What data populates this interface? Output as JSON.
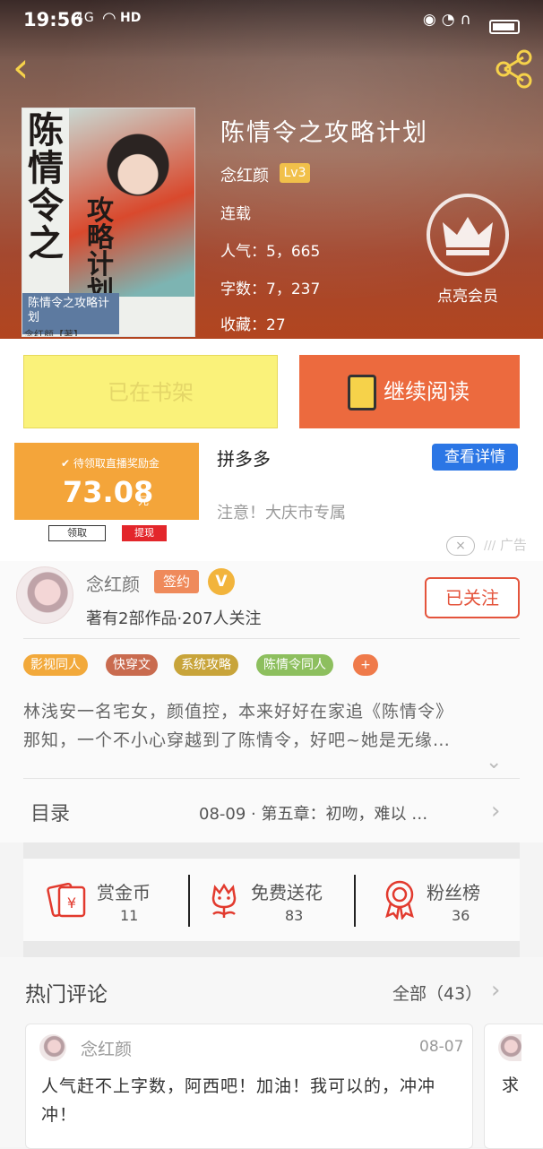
{
  "status_bar": {
    "time": "19:56",
    "network": "4G",
    "hd": "HD"
  },
  "book": {
    "title": "陈情令之攻略计划",
    "author": "念红颜",
    "level": "Lv3",
    "status": "连载",
    "popularity": "人气：5，665",
    "words": "字数：7，237",
    "favorites": "收藏：27",
    "cover": {
      "title_main": "陈情令之",
      "title_sub": "攻略计划",
      "box_text": "陈情令之攻略计划",
      "author_mark": "念红颜【著】"
    }
  },
  "vip": {
    "label": "点亮会员"
  },
  "buttons": {
    "shelf": "已在书架",
    "read": "继续阅读"
  },
  "ad": {
    "tip": "✔ 待领取直播奖励金",
    "amount": "73.08",
    "unit": "元",
    "get": "领取",
    "cash": "提现",
    "title": "拼多多",
    "detail": "查看详情",
    "desc": "注意！大庆市专属",
    "close": "×",
    "label": "广告"
  },
  "author_panel": {
    "name": "念红颜",
    "sign_badge": "签约",
    "v_badge": "V",
    "works": "著有2部作品·207人关注",
    "follow": "已关注"
  },
  "tags": [
    {
      "label": "影视同人",
      "color": "#f2a93b"
    },
    {
      "label": "快穿文",
      "color": "#c96b4f"
    },
    {
      "label": "系统攻略",
      "color": "#c8a43a"
    },
    {
      "label": "陈情令同人",
      "color": "#8dbf5e"
    },
    {
      "label": "+",
      "color": "#ef7a4a"
    }
  ],
  "synopsis": {
    "line1": "林浅安一名宅女，颜值控，本来好好在家追《陈情令》",
    "line2": "那知，一个不小心穿越到了陈情令，好吧~她是无缘…"
  },
  "toc": {
    "label": "目录",
    "latest": "08-09 · 第五章：初吻，难以 …"
  },
  "actions": [
    {
      "label": "赏金币",
      "value": "11"
    },
    {
      "label": "免费送花",
      "value": "83"
    },
    {
      "label": "粉丝榜",
      "value": "36"
    }
  ],
  "comments": {
    "title": "热门评论",
    "all": "全部（43）",
    "items": [
      {
        "name": "念红颜",
        "date": "08-07",
        "text": "人气赶不上字数，阿西吧！加油！我可以的，冲冲冲！"
      },
      {
        "text": "求"
      }
    ]
  },
  "colors": {
    "accent": "#ec6a3e",
    "shelf_bg": "#faf27a",
    "follow": "#e4543c",
    "ad_blue": "#2b76e5",
    "ad_orange": "#f4a53a"
  }
}
